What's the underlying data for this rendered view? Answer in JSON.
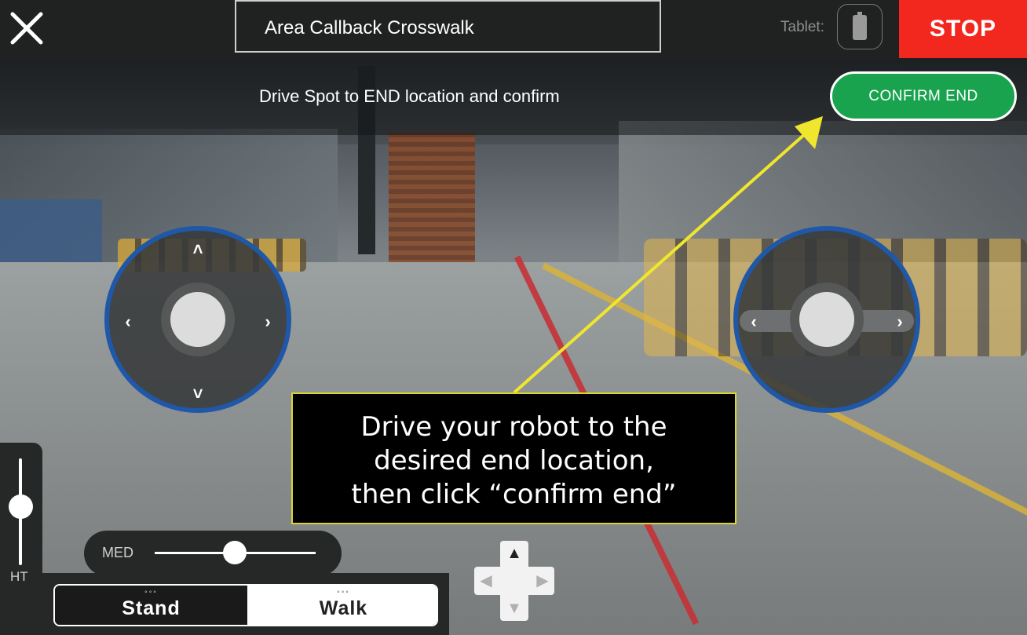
{
  "header": {
    "title": "Area Callback Crosswalk",
    "tablet_label": "Tablet:",
    "stop_label": "STOP"
  },
  "instruction": {
    "text": "Drive Spot to END location and confirm",
    "confirm_label": "CONFIRM END"
  },
  "tooltip": {
    "line1": "Drive your robot to the",
    "line2": "desired end location,",
    "line3": "then click “confirm end”"
  },
  "height_control": {
    "label": "HT"
  },
  "speed_control": {
    "label": "MED"
  },
  "mode_toggle": {
    "stand_label": "Stand",
    "walk_label": "Walk",
    "selected": "Walk"
  },
  "colors": {
    "stop": "#f2281e",
    "confirm": "#1aa34f",
    "joystick_ring": "#1f58a8",
    "callout": "#f0e62e"
  }
}
